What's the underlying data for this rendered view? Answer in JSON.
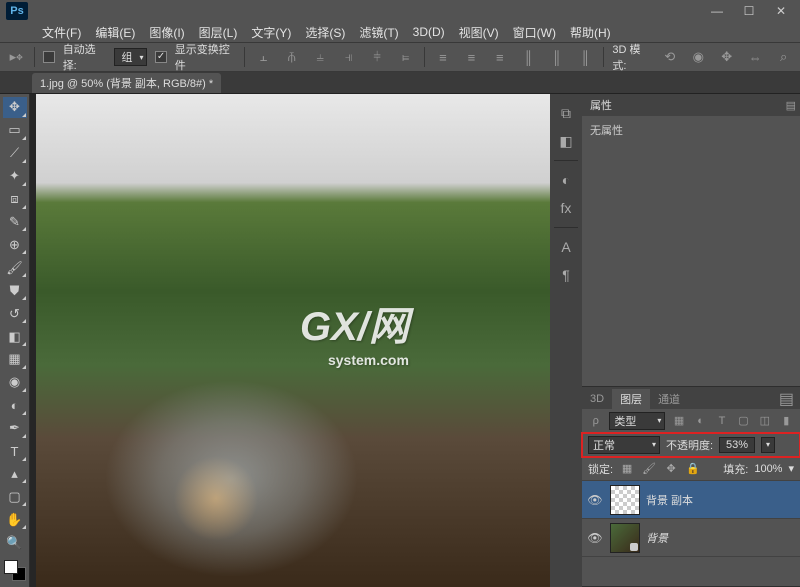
{
  "app": {
    "logo": "Ps"
  },
  "menu": [
    "文件(F)",
    "编辑(E)",
    "图像(I)",
    "图层(L)",
    "文字(Y)",
    "选择(S)",
    "滤镜(T)",
    "3D(D)",
    "视图(V)",
    "窗口(W)",
    "帮助(H)"
  ],
  "options": {
    "auto_select": "自动选择:",
    "group": "组",
    "show_transform": "显示变换控件",
    "mode3d": "3D 模式:"
  },
  "tab": {
    "title": "1.jpg @ 50% (背景 副本, RGB/8#) *"
  },
  "watermark": {
    "main": "GX/网",
    "sub": "system.com"
  },
  "properties": {
    "title": "属性",
    "none": "无属性"
  },
  "layers_panel": {
    "tabs": [
      "3D",
      "图层",
      "通道"
    ],
    "kind": "类型",
    "blend": "正常",
    "opacity_label": "不透明度:",
    "opacity_value": "53%",
    "lock_label": "锁定:",
    "fill_label": "填充:",
    "fill_value": "100%",
    "layers": [
      {
        "name": "背景 副本",
        "locked": false
      },
      {
        "name": "背景",
        "locked": true
      }
    ]
  }
}
